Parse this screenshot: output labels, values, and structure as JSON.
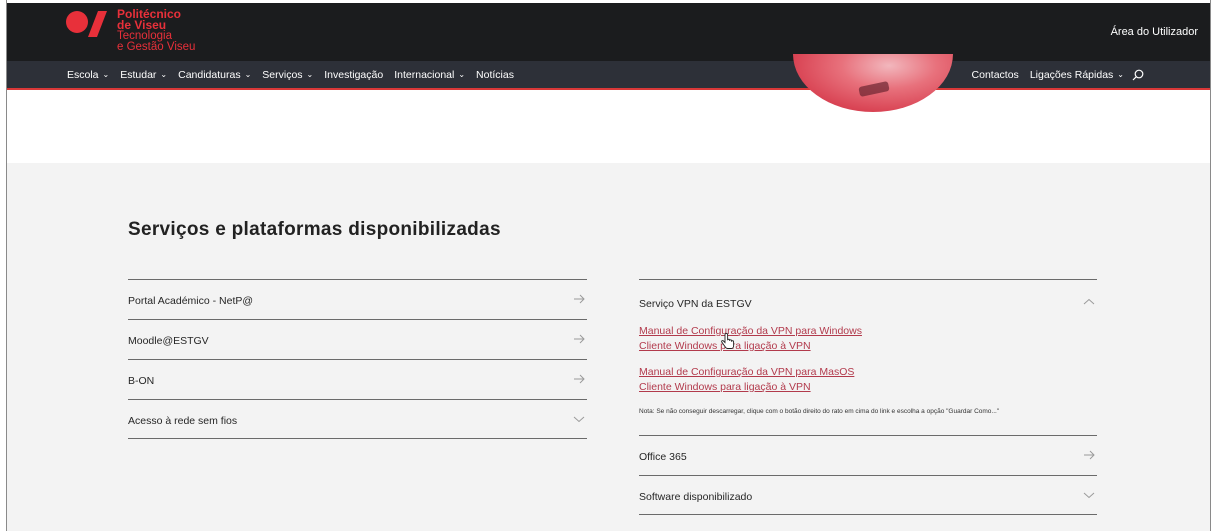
{
  "header": {
    "logo": {
      "line1": "Politécnico",
      "line2": "de Viseu",
      "line3": "Tecnologia",
      "line4": "e Gestão Viseu",
      "brand_color": "#e8303a"
    },
    "user_area_label": "Área do Utilizador"
  },
  "nav": {
    "left": [
      {
        "label": "Escola",
        "dropdown": true
      },
      {
        "label": "Estudar",
        "dropdown": true
      },
      {
        "label": "Candidaturas",
        "dropdown": true
      },
      {
        "label": "Serviços",
        "dropdown": true
      },
      {
        "label": "Investigação",
        "dropdown": false
      },
      {
        "label": "Internacional",
        "dropdown": true
      },
      {
        "label": "Notícias",
        "dropdown": false
      }
    ],
    "right": [
      {
        "label": "Contactos",
        "dropdown": false
      },
      {
        "label": "Ligações Rápidas",
        "dropdown": true
      }
    ],
    "search_icon": "search-icon",
    "accent_color": "#d93838"
  },
  "section": {
    "title": "Serviços e plataformas disponibilizadas",
    "left_items": [
      {
        "label": "Portal Académico - NetP@",
        "icon": "arrow-right-icon"
      },
      {
        "label": "Moodle@ESTGV",
        "icon": "arrow-right-icon"
      },
      {
        "label": "B-ON",
        "icon": "arrow-right-icon"
      },
      {
        "label": "Acesso à rede sem fios",
        "icon": "chevron-down-icon"
      }
    ],
    "vpn": {
      "label": "Serviço VPN da ESTGV",
      "icon": "chevron-up-icon",
      "links": [
        "Manual de Configuração da VPN para Windows",
        "Cliente Windows para ligação à VPN",
        "Manual de Configuração da VPN para MasOS",
        "Cliente Windows para ligação à VPN"
      ],
      "note": "Nota: Se não conseguir descarregar, clique com o botão direito do rato em cima do link e escolha a opção \"Guardar Como...\"",
      "link_color": "#b23a4c"
    },
    "right_items": [
      {
        "label": "Office 365",
        "icon": "arrow-right-icon"
      },
      {
        "label": "Software disponibilizado",
        "icon": "chevron-down-icon"
      }
    ]
  }
}
